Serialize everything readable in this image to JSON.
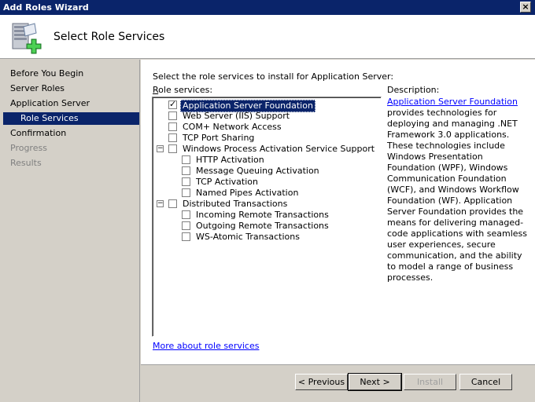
{
  "window": {
    "title": "Add Roles Wizard",
    "close_glyph": "×"
  },
  "header": {
    "title": "Select Role Services",
    "icon": "server-add-icon"
  },
  "sidebar": {
    "items": [
      {
        "label": "Before You Begin",
        "state": "normal"
      },
      {
        "label": "Server Roles",
        "state": "normal"
      },
      {
        "label": "Application Server",
        "state": "normal"
      },
      {
        "label": "Role Services",
        "state": "selected"
      },
      {
        "label": "Confirmation",
        "state": "normal"
      },
      {
        "label": "Progress",
        "state": "disabled"
      },
      {
        "label": "Results",
        "state": "disabled"
      }
    ]
  },
  "content": {
    "instruction": "Select the role services to install for Application Server:",
    "role_services_label_key": "R",
    "role_services_label_rest": "ole services:",
    "description_label": "Description:",
    "description_link": "Application Server Foundation",
    "description_text": "provides technologies for deploying and managing .NET Framework 3.0 applications. These technologies include Windows Presentation Foundation (WPF), Windows Communication Foundation (WCF), and Windows Workflow Foundation (WF). Application Server Foundation provides the means for delivering managed-code applications with seamless user experiences, secure communication, and the ability to model a range of business processes.",
    "more_link": "More about role services"
  },
  "tree": [
    {
      "label": "Application Server Foundation",
      "checked": true,
      "selected": true
    },
    {
      "label": "Web Server (IIS) Support",
      "checked": false
    },
    {
      "label": "COM+ Network Access",
      "checked": false
    },
    {
      "label": "TCP Port Sharing",
      "checked": false
    },
    {
      "label": "Windows Process Activation Service Support",
      "checked": false,
      "expander": "−"
    },
    {
      "label": "HTTP Activation",
      "checked": false
    },
    {
      "label": "Message Queuing Activation",
      "checked": false
    },
    {
      "label": "TCP Activation",
      "checked": false
    },
    {
      "label": "Named Pipes Activation",
      "checked": false
    },
    {
      "label": "Distributed Transactions",
      "checked": false,
      "expander": "−"
    },
    {
      "label": "Incoming Remote Transactions",
      "checked": false
    },
    {
      "label": "Outgoing Remote Transactions",
      "checked": false
    },
    {
      "label": "WS-Atomic Transactions",
      "checked": false
    }
  ],
  "buttons": {
    "previous": "< Previous",
    "next": "Next >",
    "install": "Install",
    "cancel": "Cancel"
  }
}
